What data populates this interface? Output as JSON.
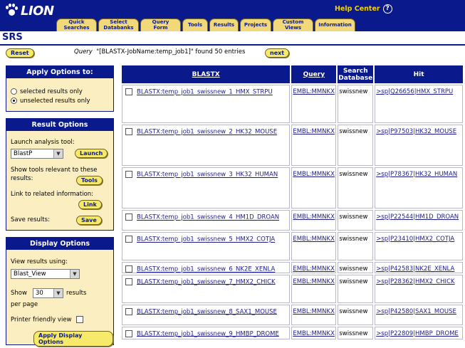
{
  "header": {
    "logo_text": "LION",
    "help_label": "Help Center",
    "help_icon": "?",
    "tabs": [
      {
        "line1": "Quick",
        "line2": "Searches"
      },
      {
        "line1": "Select",
        "line2": "Databanks"
      },
      {
        "line1": "Query",
        "line2": "Form"
      },
      {
        "line1": "Tools",
        "line2": ""
      },
      {
        "line1": "Results",
        "line2": ""
      },
      {
        "line1": "Projects",
        "line2": ""
      },
      {
        "line1": "Custom",
        "line2": "Views"
      },
      {
        "line1": "Information",
        "line2": ""
      }
    ]
  },
  "page_title": "SRS",
  "toolbar": {
    "reset_label": "Reset",
    "query_prefix": "Query",
    "query_text": "\"[BLASTX-JobName:temp_job1]\" found 50 entries",
    "next_label": "next"
  },
  "apply_panel": {
    "title": "Apply Options to:",
    "option_selected": "selected results only",
    "option_unselected": "unselected results only"
  },
  "result_panel": {
    "title": "Result Options",
    "launch_label": "Launch analysis tool:",
    "tool_value": "BlastP",
    "launch_button": "Launch",
    "show_tools_label": "Show tools relevant to these results:",
    "tools_button": "Tools",
    "link_label": "Link to related information:",
    "link_button": "Link",
    "save_label": "Save results:",
    "save_button": "Save"
  },
  "display_panel": {
    "title": "Display Options",
    "view_label": "View results using:",
    "view_value": "Blast_View",
    "show_label": "Show",
    "show_value": "30",
    "results_label": "results",
    "per_page_label": "per page",
    "printer_label": "Printer friendly view",
    "apply_button": "Apply Display Options"
  },
  "table": {
    "headers": {
      "blastx": "BLASTX",
      "query": "Query",
      "search_db": "Search Database",
      "hit": "Hit"
    },
    "rows": [
      {
        "blastx": "BLASTX:temp_job1_swissnew_1_HMX_STRPU",
        "query": "EMBL:MMNKX",
        "db": "swissnew",
        "hit": ">sp|Q26656|HMX_STRPU"
      },
      {
        "blastx": "BLASTX:temp_job1_swissnew_2_HK32_MOUSE",
        "query": "EMBL:MMNKX",
        "db": "swissnew",
        "hit": ">sp|P97503|HK32_MOUSE"
      },
      {
        "blastx": "BLASTX:temp_job1_swissnew_3_HK32_HUMAN",
        "query": "EMBL:MMNKX",
        "db": "swissnew",
        "hit": ">sp|P78367|HK32_HUMAN"
      },
      {
        "blastx": "BLASTX:temp_job1_swissnew_4_HM1D_DROAN",
        "query": "EMBL:MMNKX",
        "db": "swissnew",
        "hit": ">sp|P22544|HM1D_DROAN"
      },
      {
        "blastx": "BLASTX:temp_job1_swissnew_5_HMX2_COTJA",
        "query": "EMBL:MMNKX",
        "db": "swissnew",
        "hit": ">sp|P23410|HMX2_COTJA"
      },
      {
        "blastx": "BLASTX:temp_job1_swissnew_6_NK2E_XENLA",
        "query": "EMBL:MMNKX",
        "db": "swissnew",
        "hit": ">sp|P42583|NK2E_XENLA"
      },
      {
        "blastx": "BLASTX:temp_job1_swissnew_7_HMX2_CHICK",
        "query": "EMBL:MMNKX",
        "db": "swissnew",
        "hit": ">sp|P28362|HMX2_CHICK"
      },
      {
        "blastx": "BLASTX:temp_job1_swissnew_8_SAX1_MOUSE",
        "query": "EMBL:MMNKX",
        "db": "swissnew",
        "hit": ">sp|P42580|SAX1_MOUSE"
      },
      {
        "blastx": "BLASTX:temp_job1_swissnew_9_HMBP_DROME",
        "query": "EMBL:MMNKX",
        "db": "swissnew",
        "hit": ">sp|P22809|HMBP_DROME"
      }
    ]
  },
  "colors": {
    "header_bg": "#0a1a8c",
    "tab_bg": "#f1d87a",
    "panel_bg": "#fbeec0",
    "button_bg": "#f7ea6a",
    "help_text": "#f0d000"
  }
}
